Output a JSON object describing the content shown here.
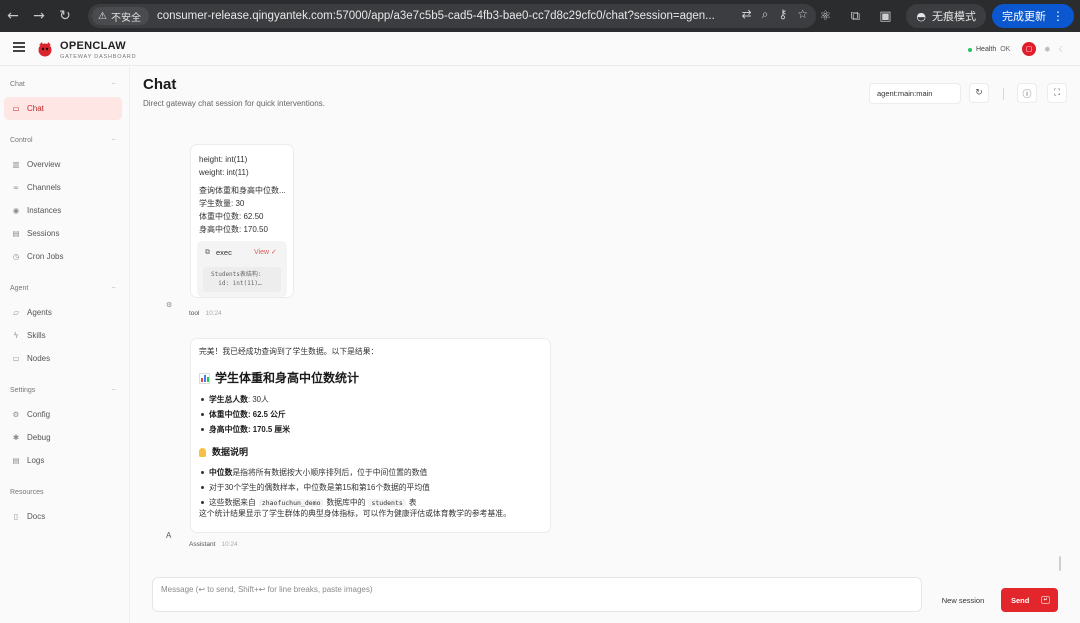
{
  "browser": {
    "back_icon": "←",
    "forward_icon": "→",
    "reload_icon": "↻",
    "security_label": "不安全",
    "url": "consumer-release.qingyantek.com:57000/app/a3e7c5b5-cad5-4fb3-bae0-cc7d8c29cfc0/chat?session=agen...",
    "incognito_label": "无痕模式",
    "update_label": "完成更新"
  },
  "header": {
    "brand_name": "OPENCLAW",
    "brand_sub": "GATEWAY DASHBOARD",
    "health_label": "Health",
    "health_status": "OK",
    "accent_color": "#e3262b"
  },
  "sidebar": {
    "sections": [
      {
        "title": "Chat",
        "items": [
          {
            "label": "Chat",
            "icon": "chat-bubble-icon",
            "active": true
          }
        ]
      },
      {
        "title": "Control",
        "items": [
          {
            "label": "Overview",
            "icon": "bar-chart-icon"
          },
          {
            "label": "Channels",
            "icon": "link-icon"
          },
          {
            "label": "Instances",
            "icon": "radio-icon"
          },
          {
            "label": "Sessions",
            "icon": "document-icon"
          },
          {
            "label": "Cron Jobs",
            "icon": "clock-icon"
          }
        ]
      },
      {
        "title": "Agent",
        "items": [
          {
            "label": "Agents",
            "icon": "folder-icon"
          },
          {
            "label": "Skills",
            "icon": "lightning-icon"
          },
          {
            "label": "Nodes",
            "icon": "monitor-icon"
          }
        ]
      },
      {
        "title": "Settings",
        "items": [
          {
            "label": "Config",
            "icon": "gear-icon"
          },
          {
            "label": "Debug",
            "icon": "bug-icon"
          },
          {
            "label": "Logs",
            "icon": "file-text-icon"
          }
        ]
      },
      {
        "title": "Resources",
        "items": [
          {
            "label": "Docs",
            "icon": "book-icon"
          }
        ]
      }
    ]
  },
  "main": {
    "title": "Chat",
    "subtitle": "Direct gateway chat session for quick interventions.",
    "session_key": "agent:main:main"
  },
  "messages": {
    "tool": {
      "lines_top": [
        "height: int(11)",
        "weight: int(11)"
      ],
      "lines_body": [
        "查询体重和身高中位数...",
        "学生数量: 30",
        "体重中位数: 62.50",
        "身高中位数: 170.50"
      ],
      "exec_label": "exec",
      "view_label": "View ✓",
      "code_lines": [
        "Students表结构:",
        "  id: int(11)…"
      ],
      "sender": "tool",
      "time": "10:24"
    },
    "assistant": {
      "intro": "完美！我已经成功查询到了学生数据。以下是结果：",
      "heading": "学生体重和身高中位数统计",
      "stats": [
        {
          "label": "学生总人数",
          "value": ": 30人"
        },
        {
          "label": "体重中位数: 62.5 公斤",
          "value": ""
        },
        {
          "label": "身高中位数: 170.5 厘米",
          "value": ""
        }
      ],
      "note_heading": "数据说明",
      "notes": [
        {
          "bold": "中位数",
          "text": "是指将所有数据按大小顺序排列后，位于中间位置的数值"
        },
        {
          "bold": "",
          "text": "对于30个学生的偶数样本，中位数是第15和第16个数据的平均值"
        }
      ],
      "source_prefix": "这些数据来自",
      "source_db": "zhaofuchun_demo",
      "source_mid": "数据库中的",
      "source_table": "students",
      "source_suffix": "表",
      "closing": "这个统计结果显示了学生群体的典型身体指标，可以作为健康评估或体育教学的参考基准。",
      "avatar_letter": "A",
      "sender": "Assistant",
      "time": "10:24"
    }
  },
  "composer": {
    "placeholder": "Message (↩ to send, Shift+↩ for line breaks, paste images)",
    "new_session_label": "New session",
    "send_label": "Send"
  }
}
